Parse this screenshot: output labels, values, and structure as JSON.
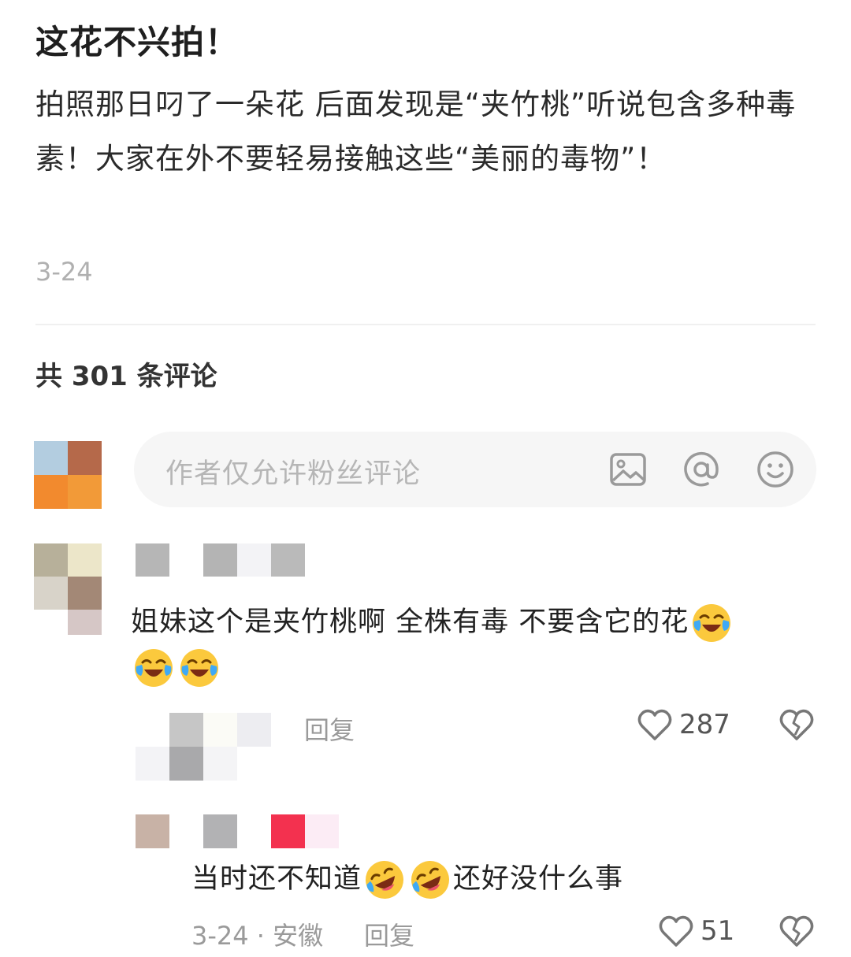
{
  "post": {
    "title": "这花不兴拍！",
    "body": "拍照那日叼了一朵花 后面发现是“夹竹桃”听说包含多种毒素！大家在外不要轻易接触这些“美丽的毒物”！",
    "date": "3-24"
  },
  "comments_header": {
    "label": "共 301 条评论"
  },
  "comment_input": {
    "placeholder": "作者仅允许粉丝评论",
    "icons": [
      "image-icon",
      "at-icon",
      "emoji-icon"
    ]
  },
  "comments": [
    {
      "text_part1": "姐妹这个是夹竹桃啊 全株有毒 不要含它的花",
      "emojis": [
        "crying-laughing-emoji",
        "crying-laughing-emoji",
        "crying-laughing-emoji"
      ],
      "reply_label": "回复",
      "likes": "287"
    }
  ],
  "reply": {
    "text_before": "当时还不知道",
    "text_after": "还好没什么事",
    "emojis": [
      "rolling-laughing-emoji",
      "rolling-laughing-emoji"
    ],
    "meta": "3-24 · 安徽",
    "reply_label": "回复",
    "likes": "51"
  }
}
